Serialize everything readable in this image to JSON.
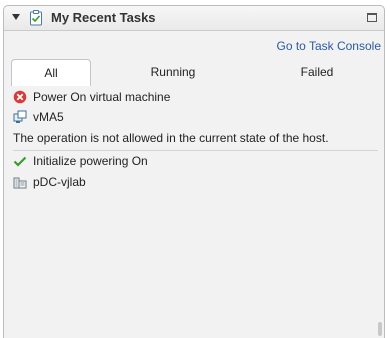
{
  "panel": {
    "title": "My Recent Tasks",
    "icons": {
      "collapse": "collapse-triangle-icon",
      "tasks": "clipboard-check-icon",
      "maximize": "maximize-icon"
    }
  },
  "console_link": "Go to Task Console",
  "tabs": [
    {
      "label": "All",
      "active": true
    },
    {
      "label": "Running",
      "active": false
    },
    {
      "label": "Failed",
      "active": false
    }
  ],
  "tasks": [
    {
      "name": "Power On virtual machine",
      "status_icon": "error-icon",
      "target": "vMA5",
      "target_icon": "virtual-machine-icon",
      "message": "The operation is not allowed in the current state of the host."
    },
    {
      "name": "Initialize powering On",
      "status_icon": "success-check-icon",
      "target": "pDC-vjlab",
      "target_icon": "datacenter-icon"
    }
  ],
  "colors": {
    "link": "#2c5aa0",
    "error": "#d63c3c",
    "success": "#3a9a2e"
  }
}
